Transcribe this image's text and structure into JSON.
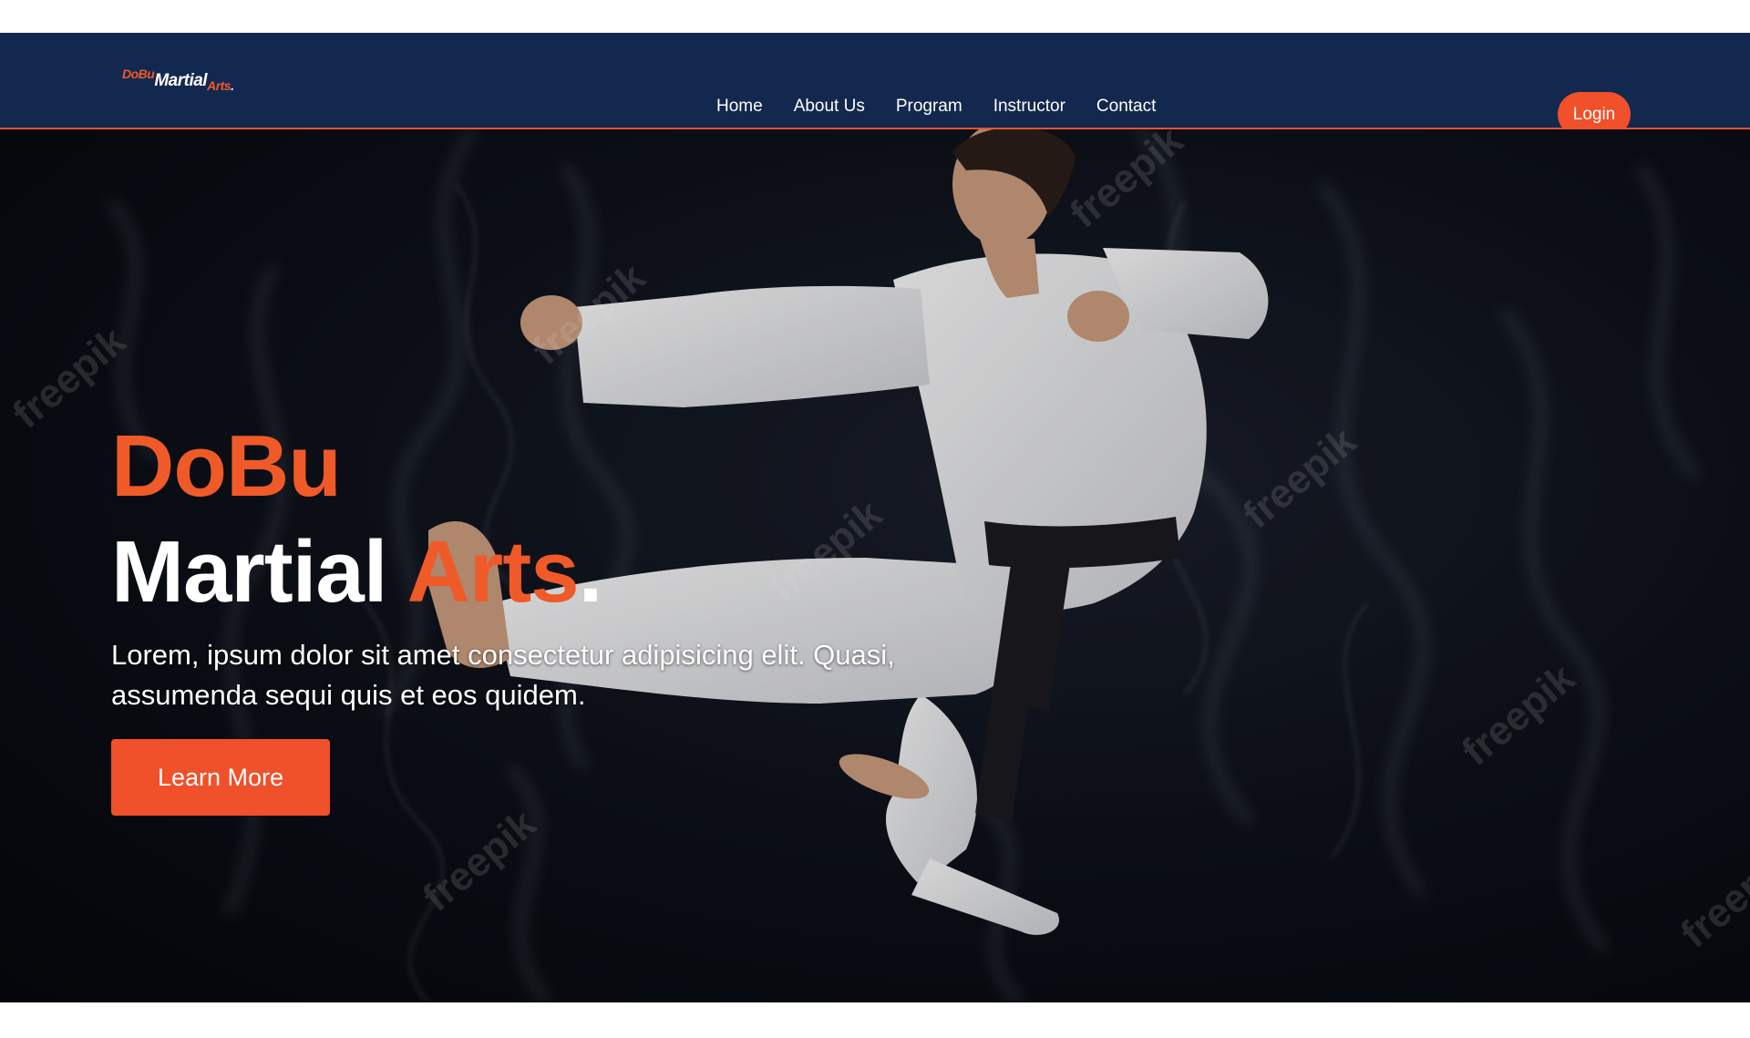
{
  "brand": {
    "logo_part1": "DoBu",
    "logo_part2": "Martial",
    "logo_part3": "Arts",
    "logo_part4": "."
  },
  "nav": {
    "items": [
      {
        "label": "Home"
      },
      {
        "label": "About Us"
      },
      {
        "label": "Program"
      },
      {
        "label": "Instructor"
      },
      {
        "label": "Contact"
      }
    ],
    "login_label": "Login"
  },
  "hero": {
    "title_line1": "DoBu",
    "title_line2_word": "Martial",
    "title_line2_accent": "Arts",
    "title_line2_dot": ".",
    "subtitle": "Lorem, ipsum dolor sit amet consectetur adipisicing elit. Quasi, assumenda sequi quis et eos quidem.",
    "cta_label": "Learn More",
    "background_image": "martial-artist-flying-kick-smoke-photo",
    "watermark_text": "freepik"
  },
  "colors": {
    "nav_bg": "#13284f",
    "accent": "#f05a28",
    "hero_bg": "#0c0f17",
    "text": "#ffffff"
  }
}
